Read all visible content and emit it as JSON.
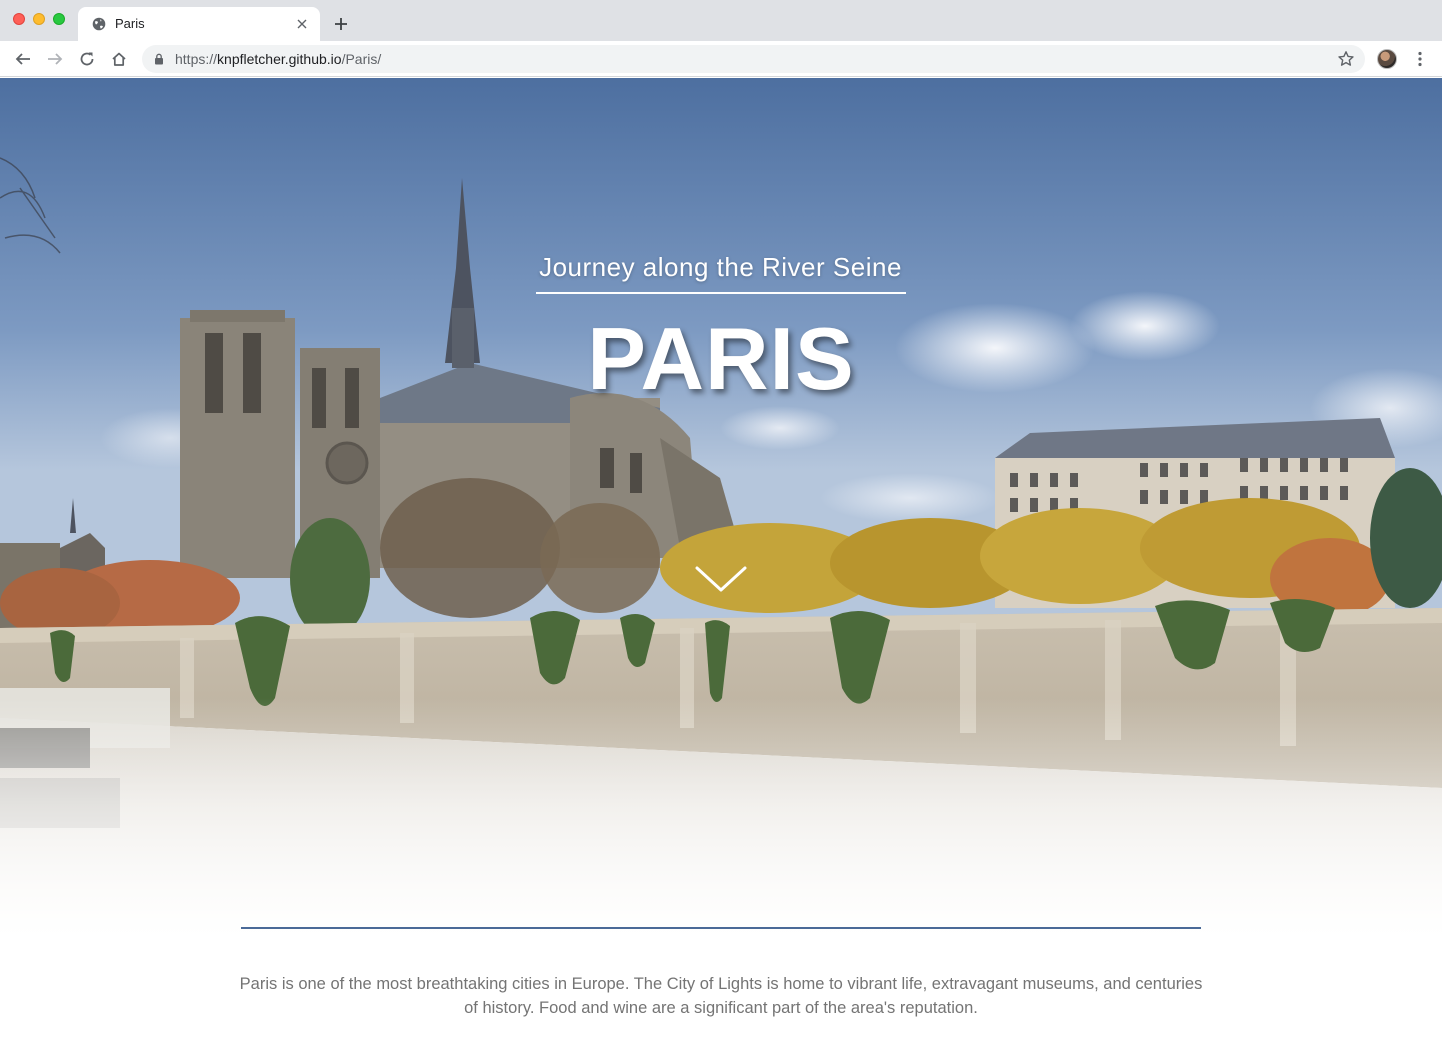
{
  "browser": {
    "tab": {
      "title": "Paris",
      "favicon": "globe-icon"
    },
    "url": {
      "scheme": "https://",
      "host": "knpfletcher.github.io",
      "path": "/Paris/"
    },
    "icons": [
      "back-icon",
      "forward-icon",
      "reload-icon",
      "home-icon",
      "lock-icon",
      "star-icon",
      "avatar",
      "menu-icon",
      "new-tab-icon",
      "close-icon"
    ]
  },
  "hero": {
    "subtitle": "Journey along the River Seine",
    "title": "PARIS",
    "scroll_icon": "chevron-down-icon"
  },
  "intro": {
    "text": "Paris is one of the most breathtaking cities in Europe. The City of Lights is home to vibrant life, extravagant museums, and centuries of history. Food and wine are a significant part of the area's reputation."
  },
  "colors": {
    "divider": "#4a6a98",
    "intro_text": "#747474",
    "sky_top": "#4d6fa0"
  }
}
